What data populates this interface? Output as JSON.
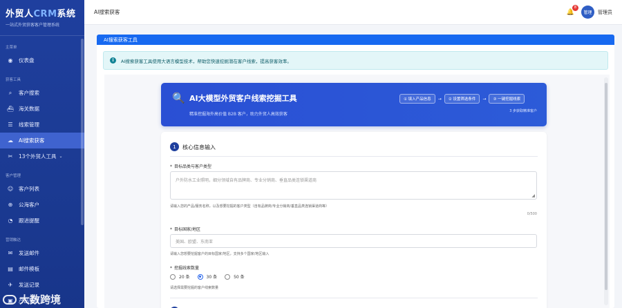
{
  "brand": {
    "title_prefix": "外贸人",
    "title_accent": "CRM",
    "title_suffix": "系统",
    "subtitle": "一站式外贸获客客户管理系统"
  },
  "sidebar": {
    "sections": [
      {
        "label": "主菜单",
        "items": [
          {
            "icon": "dashboard-icon",
            "glyph": "◉",
            "label": "仪表盘"
          }
        ]
      },
      {
        "label": "获客工具",
        "items": [
          {
            "icon": "search-icon",
            "glyph": "⌕",
            "label": "客户搜索"
          },
          {
            "icon": "ship-icon",
            "glyph": "⛴",
            "label": "海关数据"
          },
          {
            "icon": "list-icon",
            "glyph": "☰",
            "label": "线索管理"
          },
          {
            "icon": "cloud-icon",
            "glyph": "☁",
            "label": "AI搜索获客",
            "active": true
          },
          {
            "icon": "tools-icon",
            "glyph": "✂",
            "label": "13个外贸人工具",
            "caret": "⌄"
          }
        ]
      },
      {
        "label": "客户管理",
        "items": [
          {
            "icon": "users-icon",
            "glyph": "☺",
            "label": "客户列表"
          },
          {
            "icon": "globe-icon",
            "glyph": "⊕",
            "label": "公海客户"
          },
          {
            "icon": "clock-icon",
            "glyph": "◔",
            "label": "跟进提醒"
          }
        ]
      },
      {
        "label": "营销触达",
        "items": [
          {
            "icon": "mail-icon",
            "glyph": "✉",
            "label": "发送邮件"
          },
          {
            "icon": "template-icon",
            "glyph": "▤",
            "label": "邮件模板"
          },
          {
            "icon": "send-record-icon",
            "glyph": "✈",
            "label": "发送记录"
          },
          {
            "icon": "box-icon",
            "glyph": "▣",
            "label": "产品管理"
          }
        ]
      }
    ],
    "watermark": "大数跨境"
  },
  "topbar": {
    "page_title": "AI搜索获客",
    "notif_count": "8",
    "avatar_text": "管理",
    "user_name": "管理员"
  },
  "panel": {
    "header": "AI搜索获客工具"
  },
  "alert": {
    "text": "AI搜索获客工具使用大语言模型技术，帮助您快速挖掘潜在客户线索，提高获客效率。"
  },
  "hero": {
    "title": "AI大模型外贸客户线索挖掘工具",
    "subtitle": "精准挖掘海外高价值 B2B 客户，助力外贸人高效获客",
    "steps": [
      "① 填入产品信息",
      "② 设置筛选条件",
      "③ 一键挖掘线索"
    ],
    "arrow": "→",
    "hint": "3 步获取精准客户"
  },
  "card": {
    "step_num": "1",
    "title": "核心信息输入",
    "field1": {
      "label": "目标品类与客户类型",
      "placeholder": "户外防水工业照明，细分领域自有品牌商、专业分销商、垂直品类连锁渠道商",
      "help": "请输入您的产品/服务名称，以及想要挖掘的客户类型（自有品牌商/专业分销商/垂直品类连锁渠道商等）",
      "counter": "0/500"
    },
    "field2": {
      "label": "目标国家/地区",
      "placeholder": "美国、欧盟、东南亚",
      "help": "请输入您想要挖掘客户的目标国家/地区，支持多个国家/地区输入"
    },
    "field3": {
      "label": "挖掘线索数量",
      "options": [
        "20 条",
        "30 条",
        "50 条"
      ],
      "selected": 1,
      "help": "请选择需要挖掘的客户线索数量"
    }
  }
}
